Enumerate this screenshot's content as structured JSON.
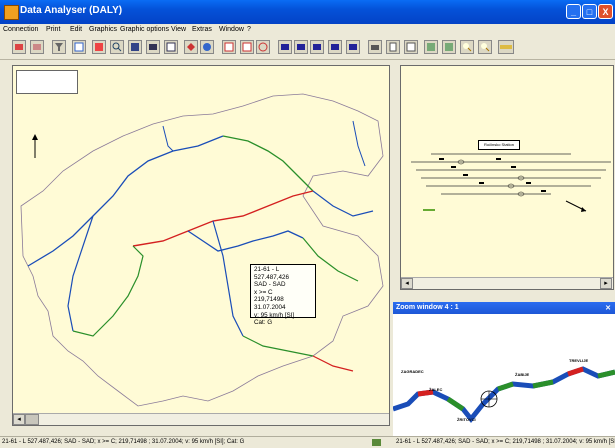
{
  "window": {
    "title": "Data Analyser (DALY)",
    "minimize": "_",
    "maximize": "□",
    "close": "X"
  },
  "menu": [
    "Connection",
    "Print",
    "Edit",
    "Graphics",
    "Graphic options",
    "View",
    "Extras",
    "Window",
    "?"
  ],
  "toolbar_icons": [
    "open-connection-icon",
    "close-connection-icon",
    "filter-icon",
    "chart-icon",
    "calculator-icon",
    "search-icon",
    "copy-icon",
    "list-icon",
    "frame-icon",
    "layers-icon",
    "info-icon",
    "save-icon",
    "export-icon",
    "settings-icon",
    "first-icon",
    "prev-icon",
    "next-icon",
    "last-icon",
    "grid-icon",
    "print-icon",
    "preview-icon",
    "close-view-icon",
    "edit-icon",
    "image-icon",
    "zoom-in-icon",
    "zoom-out-icon",
    "ruler-icon"
  ],
  "right_window": {
    "station_label": "Ročinsko Station"
  },
  "zoom_window": {
    "title": "Zoom window 4 : 1",
    "labels": [
      "ZAGRADEC",
      "ŽABIJE",
      "TREVLIJE",
      "ŽALEC",
      "ŽRITOVCI"
    ]
  },
  "tooltip": {
    "line1": "21-61 - L 527.487,426",
    "line2": "SAD - SAD",
    "line3": "x >= C",
    "line4": "219,71498",
    "line5": "31.07.2004",
    "line6": "v: 95 km/h [SI]",
    "line7": "Cat: G"
  },
  "status": {
    "left": "21-61 - L 527.487,426; SAD - SAD; x >= C; 219,71498 ; 31.07.2004; v: 95 km/h [SI]; Cat: G",
    "right": "21-61 - L 527.487,426; SAD - SAD; x >= C; 219,71498 ; 31.07.2004; v: 95 km/h [SI]"
  },
  "colors": {
    "title_blue": "#0451d8",
    "map_background": "#fffbd6",
    "track_blue": "#1a4db8",
    "track_green": "#2a8f2a",
    "track_red": "#d42020"
  }
}
